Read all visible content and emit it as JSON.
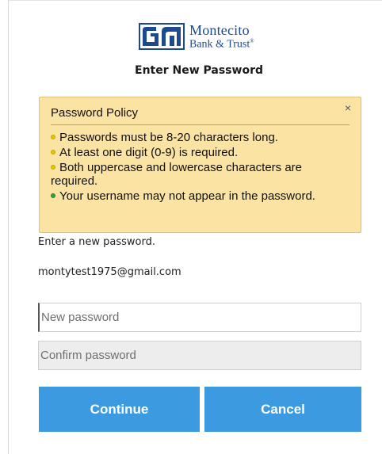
{
  "brand": {
    "line1": "Montecito",
    "line2": "Bank & Trust",
    "reg": "®",
    "color": "#1d4a8c"
  },
  "page": {
    "title": "Enter New Password",
    "instruction": "Enter a new password.",
    "username": "montytest1975@gmail.com"
  },
  "policy": {
    "title": "Password Policy",
    "close": "×",
    "rules": [
      {
        "text": "Passwords must be 8-20 characters long.",
        "status": "warn"
      },
      {
        "text": "At least one digit (0-9) is required.",
        "status": "warn"
      },
      {
        "text": "Both uppercase and lowercase characters are required.",
        "status": "warn"
      },
      {
        "text": "Your username may not appear in the password.",
        "status": "ok"
      }
    ],
    "background": "#fbe3a4"
  },
  "form": {
    "new_password": {
      "value": "",
      "placeholder": "New password"
    },
    "confirm_password": {
      "value": "",
      "placeholder": "Confirm password"
    },
    "continue_label": "Continue",
    "cancel_label": "Cancel",
    "button_color": "#3c9ae0"
  }
}
